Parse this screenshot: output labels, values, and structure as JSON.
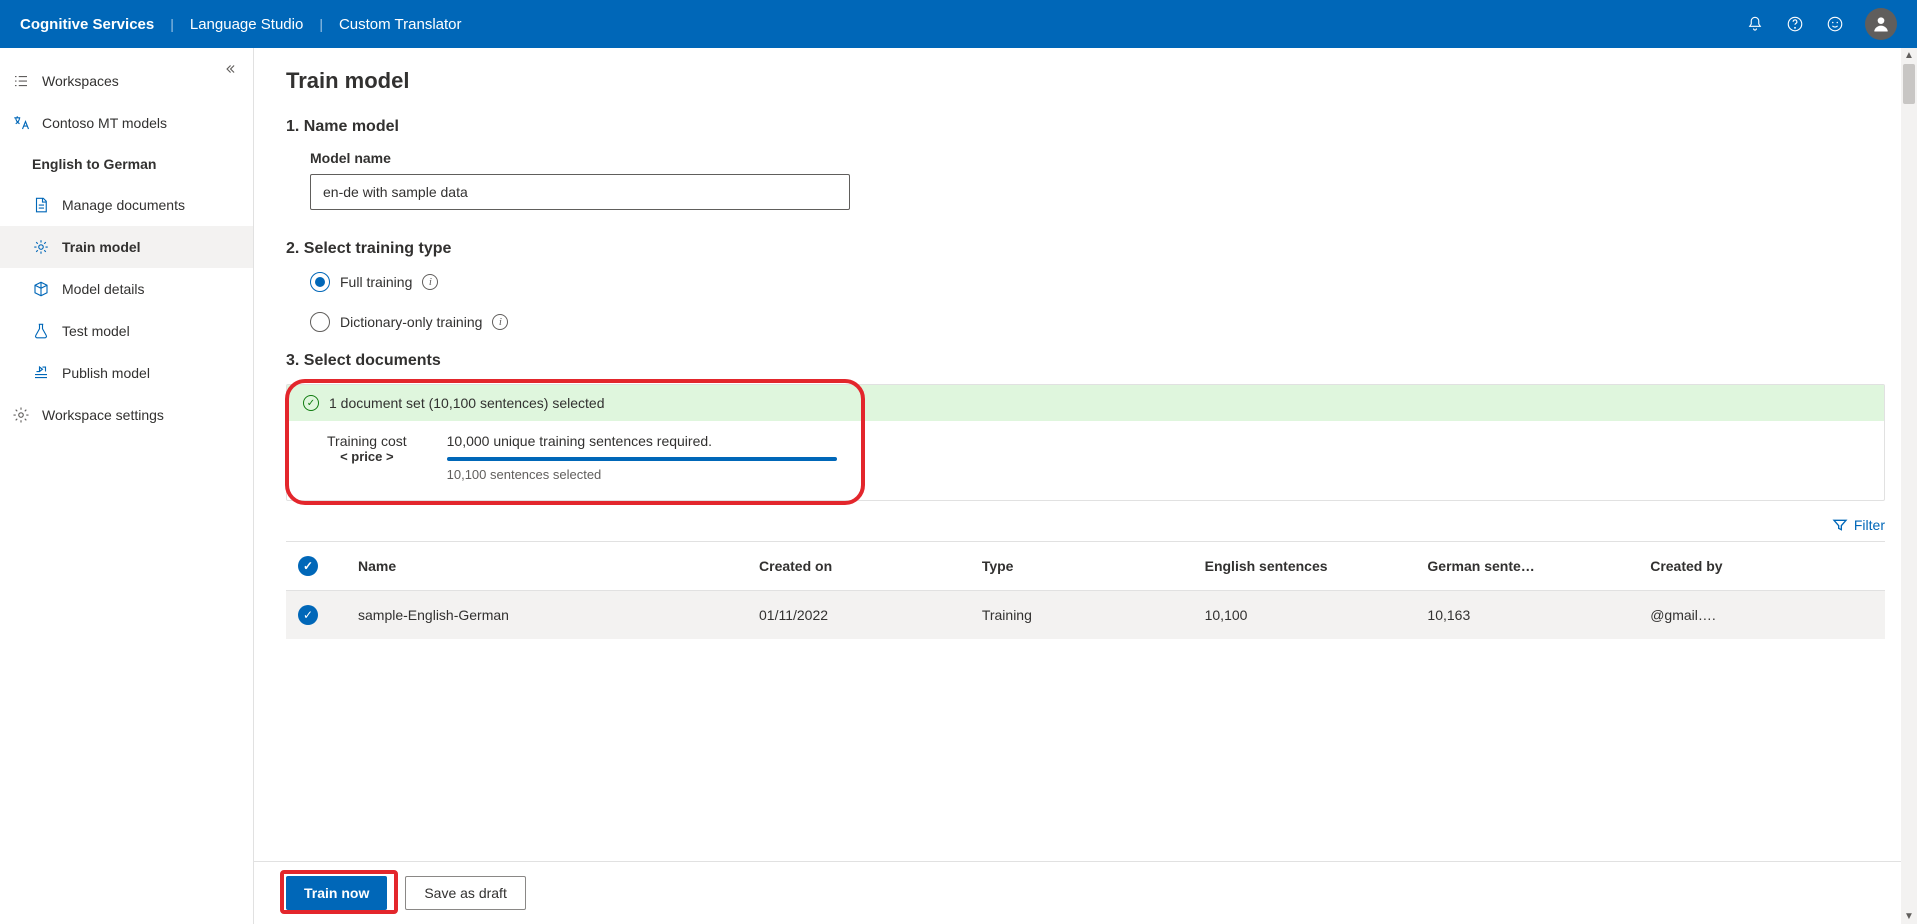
{
  "header": {
    "brand": "Cognitive Services",
    "studio": "Language Studio",
    "product": "Custom Translator"
  },
  "sidebar": {
    "workspaces": "Workspaces",
    "workspace_name": "Contoso MT models",
    "project_name": "English to German",
    "items": [
      {
        "label": "Manage documents"
      },
      {
        "label": "Train model"
      },
      {
        "label": "Model details"
      },
      {
        "label": "Test model"
      },
      {
        "label": "Publish model"
      }
    ],
    "workspace_settings": "Workspace settings"
  },
  "main": {
    "title": "Train model",
    "step1": {
      "heading": "1. Name model",
      "label": "Model name",
      "value": "en-de with sample data"
    },
    "step2": {
      "heading": "2. Select training type",
      "opt_full": "Full training",
      "opt_dict": "Dictionary-only training"
    },
    "step3": {
      "heading": "3. Select documents",
      "selected_summary": "1 document set (10,100 sentences) selected",
      "cost_label": "Training cost",
      "cost_price": "< price >",
      "required": "10,000 unique training sentences required.",
      "selected_detail": "10,100 sentences selected",
      "filter": "Filter"
    },
    "table": {
      "headers": {
        "name": "Name",
        "created_on": "Created on",
        "type": "Type",
        "eng": "English sentences",
        "ger": "German sente…",
        "created_by": "Created by"
      },
      "rows": [
        {
          "name": "sample-English-German",
          "created_on": "01/11/2022",
          "type": "Training",
          "eng": "10,100",
          "ger": "10,163",
          "created_by": "@gmail…."
        }
      ]
    },
    "footer": {
      "train_now": "Train now",
      "save_draft": "Save as draft"
    }
  }
}
